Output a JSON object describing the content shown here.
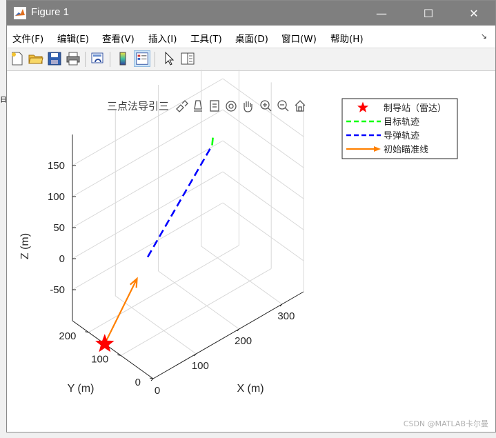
{
  "window": {
    "title": "Figure 1",
    "controls": {
      "minimize": "—",
      "maximize": "☐",
      "close": "✕"
    }
  },
  "menu": [
    "文件(F)",
    "编辑(E)",
    "查看(V)",
    "插入(I)",
    "工具(T)",
    "桌面(D)",
    "窗口(W)",
    "帮助(H)"
  ],
  "toolbar": [
    "new-file",
    "open-folder",
    "save",
    "print",
    "link-plot",
    "colorbar",
    "legend",
    "pointer",
    "property-inspector"
  ],
  "axes_toolbar": [
    "brush",
    "data-tip",
    "data-cursor",
    "rotate-3d",
    "pan",
    "zoom-in",
    "zoom-out",
    "restore-view"
  ],
  "chart_data": {
    "type": "line3d",
    "title": "三点法导引三",
    "xlabel": "X (m)",
    "ylabel": "Y (m)",
    "zlabel": "Z (m)",
    "xticks": [
      "0",
      "100",
      "200",
      "300"
    ],
    "yticks": [
      "0",
      "100",
      "200"
    ],
    "zticks": [
      "-50",
      "0",
      "50",
      "100",
      "150"
    ],
    "xlim": [
      0,
      350
    ],
    "ylim": [
      0,
      250
    ],
    "zlim": [
      -100,
      200
    ],
    "grid": true,
    "legend_position": "top-right",
    "series": [
      {
        "name": "制导站（雷达）",
        "style": "star",
        "color": "#ff0000",
        "points": [
          [
            0,
            150,
            -100
          ]
        ]
      },
      {
        "name": "目标轨迹",
        "style": "dashed",
        "color": "#00ff00",
        "points": [
          [
            250,
            150,
            120
          ],
          [
            260,
            160,
            130
          ]
        ]
      },
      {
        "name": "导弹轨迹",
        "style": "dashed",
        "color": "#0000ff",
        "points": [
          [
            100,
            150,
            0
          ],
          [
            250,
            150,
            120
          ]
        ]
      },
      {
        "name": "初始瞄准线",
        "style": "arrow",
        "color": "#ff8000",
        "points": [
          [
            0,
            150,
            -100
          ],
          [
            75,
            150,
            -25
          ]
        ]
      }
    ]
  },
  "watermark": "CSDN @MATLAB卡尔曼"
}
